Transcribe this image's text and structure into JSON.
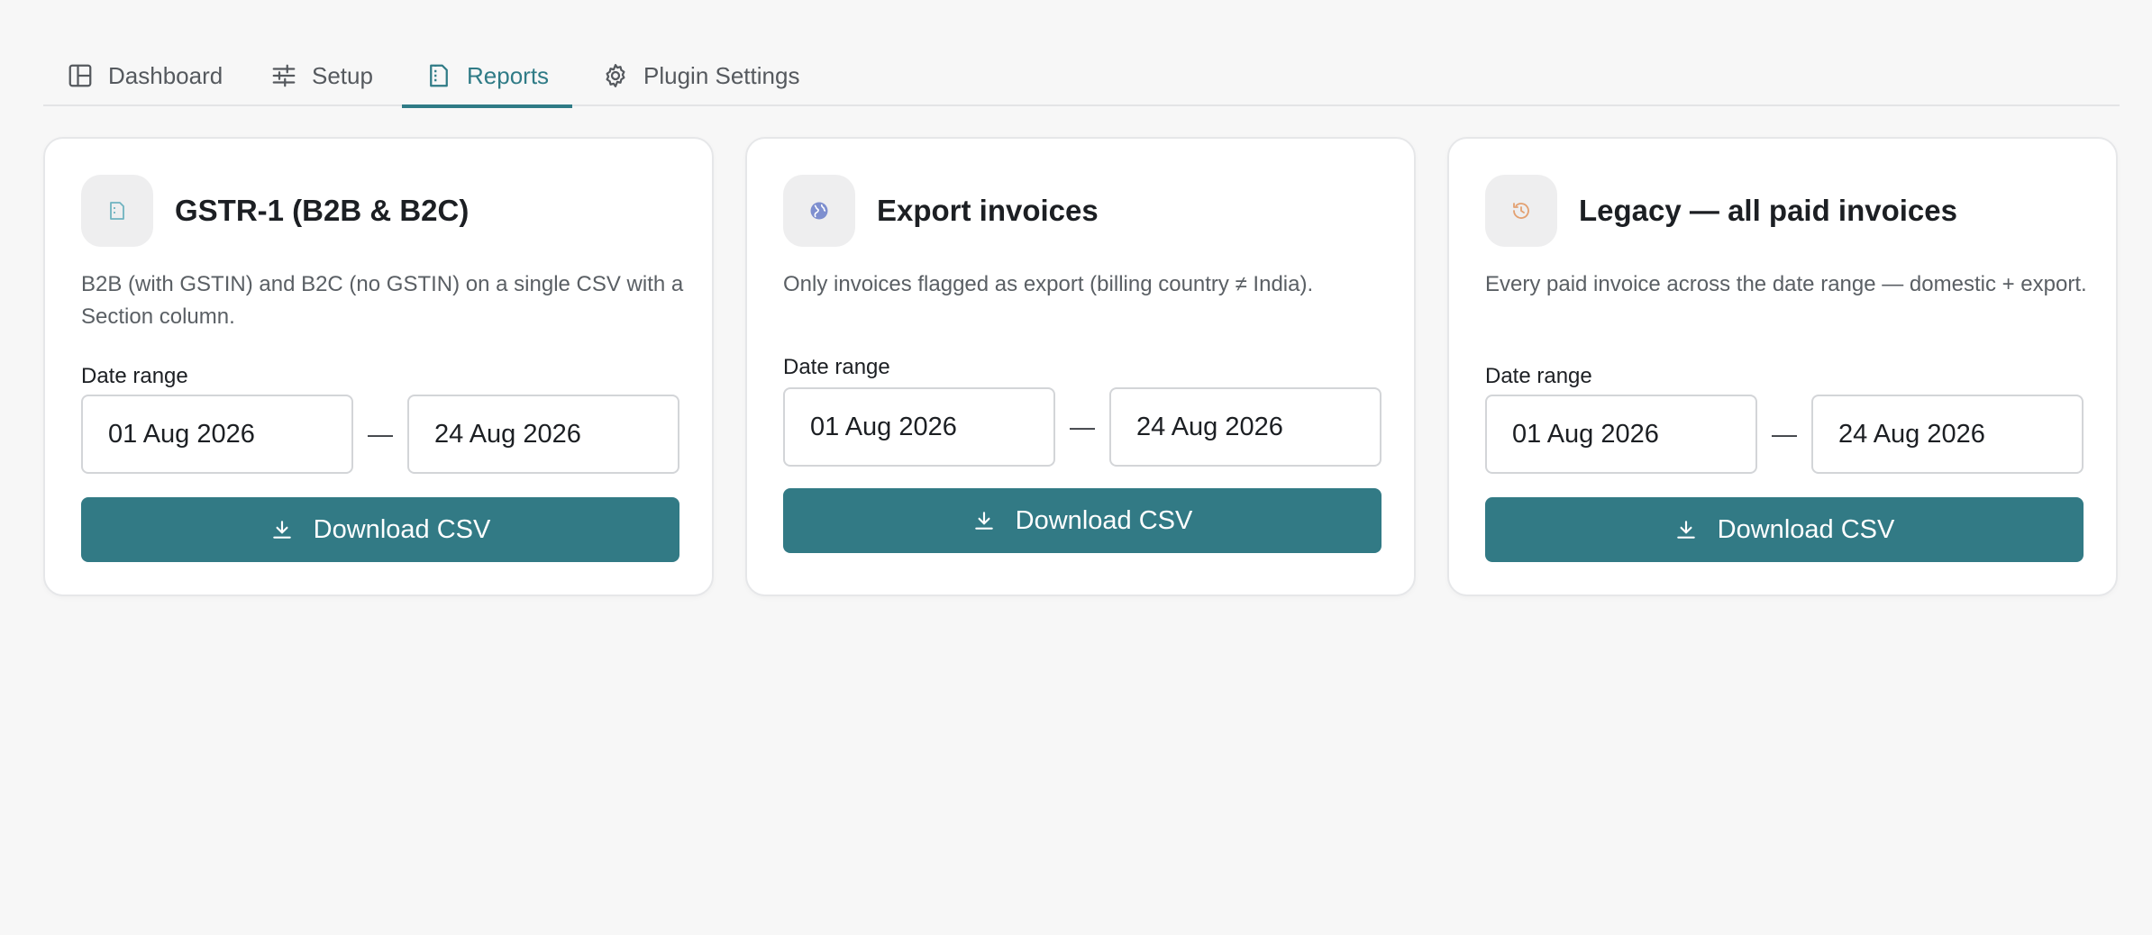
{
  "tabs": [
    {
      "label": "Dashboard",
      "icon": "layout-icon",
      "active": false
    },
    {
      "label": "Setup",
      "icon": "sliders-icon",
      "active": false
    },
    {
      "label": "Reports",
      "icon": "report-icon",
      "active": true
    },
    {
      "label": "Plugin Settings",
      "icon": "gear-icon",
      "active": false
    }
  ],
  "colors": {
    "accent": "#2f7b86",
    "button": "#327a85",
    "gstr_icon": "#6fb3c0",
    "export_icon": "#7e8fcf",
    "legacy_icon": "#e3a070"
  },
  "cards": [
    {
      "title": "GSTR-1 (B2B & B2C)",
      "description": "B2B (with GSTIN) and B2C (no GSTIN) on a single CSV with a Section column.",
      "icon": "document-icon",
      "range_label": "Date range",
      "from": "01 Aug 2026",
      "separator": "—",
      "to": "24 Aug 2026",
      "button_label": "Download CSV"
    },
    {
      "title": "Export invoices",
      "description": "Only invoices flagged as export (billing country ≠ India).",
      "icon": "globe-icon",
      "range_label": "Date range",
      "from": "01 Aug 2026",
      "separator": "—",
      "to": "24 Aug 2026",
      "button_label": "Download CSV"
    },
    {
      "title": "Legacy — all paid invoices",
      "description": "Every paid invoice across the date range — domestic + export.",
      "icon": "history-icon",
      "range_label": "Date range",
      "from": "01 Aug 2026",
      "separator": "—",
      "to": "24 Aug 2026",
      "button_label": "Download CSV"
    }
  ]
}
